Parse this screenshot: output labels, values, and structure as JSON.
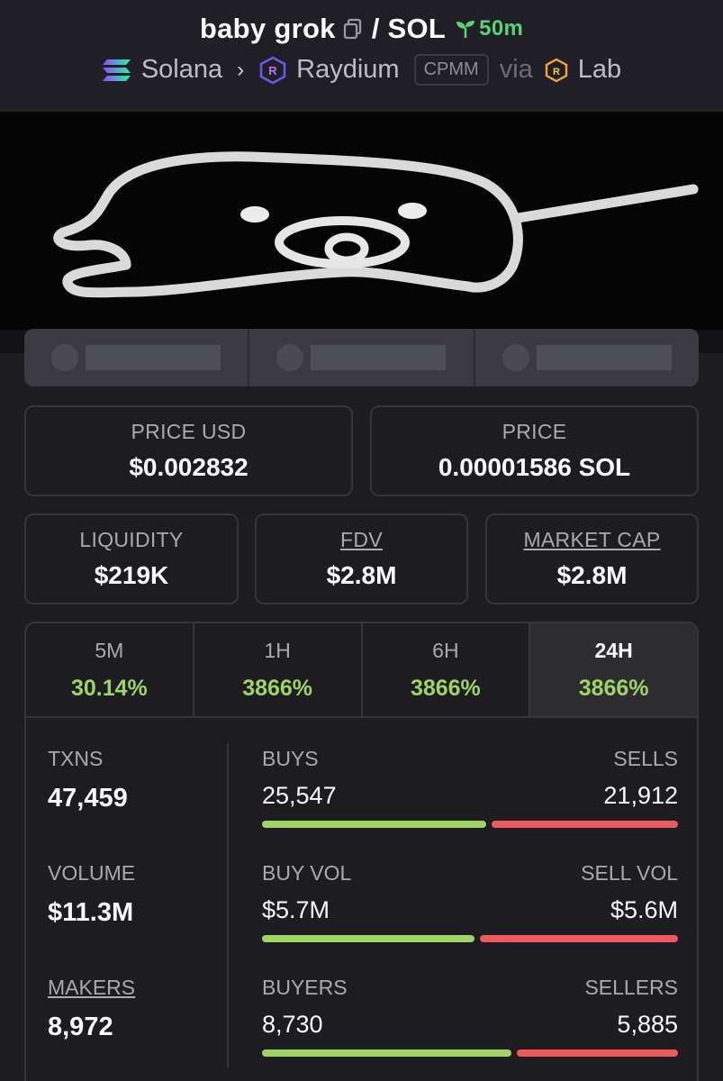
{
  "header": {
    "token": "baby grok",
    "pair_sep": "/ SOL",
    "age": "50m",
    "chain": "Solana",
    "dex": "Raydium",
    "pool_type": "CPMM",
    "via": "via",
    "launchpad": "Lab"
  },
  "prices": {
    "price_usd_label": "PRICE USD",
    "price_usd": "$0.002832",
    "price_label": "PRICE",
    "price_native": "0.00001586 SOL"
  },
  "metrics": {
    "liquidity_label": "LIQUIDITY",
    "liquidity": "$219K",
    "fdv_label": "FDV",
    "fdv": "$2.8M",
    "mcap_label": "MARKET CAP",
    "mcap": "$2.8M"
  },
  "tabs": [
    {
      "label": "5M",
      "change": "30.14%"
    },
    {
      "label": "1H",
      "change": "3866%"
    },
    {
      "label": "6H",
      "change": "3866%"
    },
    {
      "label": "24H",
      "change": "3866%"
    }
  ],
  "stats": {
    "txns_label": "TXNS",
    "txns": "47,459",
    "volume_label": "VOLUME",
    "volume": "$11.3M",
    "makers_label": "MAKERS",
    "makers": "8,972",
    "buys_label": "BUYS",
    "buys": "25,547",
    "sells_label": "SELLS",
    "sells": "21,912",
    "buy_ratio": 0.54,
    "buyvol_label": "BUY VOL",
    "buyvol": "$5.7M",
    "sellvol_label": "SELL VOL",
    "sellvol": "$5.6M",
    "vol_ratio": 0.51,
    "buyers_label": "BUYERS",
    "buyers": "8,730",
    "sellers_label": "SELLERS",
    "sellers": "5,885",
    "buyer_ratio": 0.6
  },
  "colors": {
    "positive": "#9fd463",
    "negative": "#ee5a5c",
    "age_green": "#59d27a"
  }
}
